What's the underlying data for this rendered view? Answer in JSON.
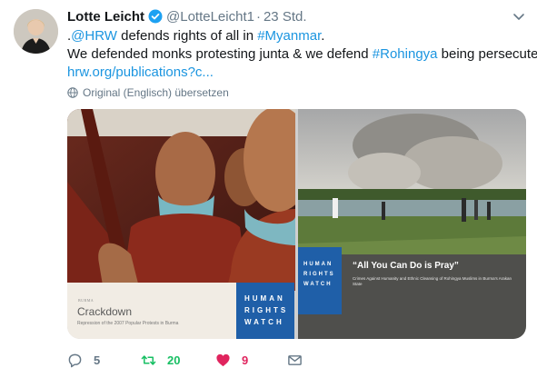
{
  "tweet": {
    "author": {
      "display_name": "Lotte Leicht",
      "handle": "@LotteLeicht1",
      "verified_icon": "verified-badge-icon"
    },
    "separator": "·",
    "time": "23 Std.",
    "text_lines": [
      [
        {
          "text": ".",
          "link": false
        },
        {
          "text": "@HRW",
          "link": true
        },
        {
          "text": " defends rights of all in ",
          "link": false
        },
        {
          "text": "#Myanmar",
          "link": true
        },
        {
          "text": ".",
          "link": false
        }
      ],
      [
        {
          "text": "We defended monks protesting junta & we defend ",
          "link": false
        },
        {
          "text": "#Rohingya",
          "link": true
        },
        {
          "text": " being persecuted",
          "link": false
        }
      ],
      [
        {
          "text": "hrw.org/publications?c...",
          "link": true
        }
      ]
    ],
    "translate_label": "Original (Englisch) übersetzen",
    "media": {
      "left_cover": {
        "series_label": "BURMA",
        "title": "Crackdown",
        "subtitle": "Repression of the 2007 Popular Protests in Burma",
        "publisher_lines": [
          "HUMAN",
          "RIGHTS",
          "WATCH"
        ]
      },
      "right_cover": {
        "title": "“All You Can Do is Pray”",
        "subtitle": "Crimes Against Humanity and Ethnic Cleansing of Rohingya Muslims in Burma’s Arakan State",
        "publisher_lines": [
          "HUMAN",
          "RIGHTS",
          "WATCH"
        ]
      }
    },
    "actions": {
      "reply": {
        "icon": "reply-icon",
        "count": "5"
      },
      "retweet": {
        "icon": "retweet-icon",
        "count": "20"
      },
      "like": {
        "icon": "heart-icon",
        "count": "9"
      },
      "dm": {
        "icon": "envelope-icon"
      }
    },
    "colors": {
      "link": "#1b95e0",
      "muted": "#657786",
      "retweet": "#17bf63",
      "like": "#e0245e",
      "hrw_blue": "#1f5fa8"
    }
  }
}
